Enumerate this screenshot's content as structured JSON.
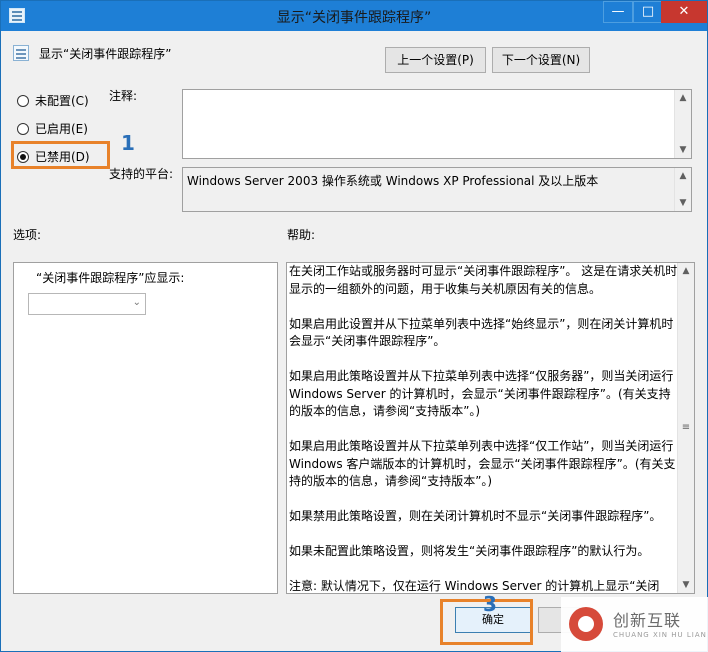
{
  "window": {
    "title": "显示“关闭事件跟踪程序”"
  },
  "titlebar_buttons": {
    "minimize": "—",
    "maximize": "□",
    "close": "✕"
  },
  "policy_name": "显示“关闭事件跟踪程序”",
  "nav": {
    "prev": "上一个设置(P)",
    "next": "下一个设置(N)"
  },
  "state_options": [
    {
      "label": "未配置(C)",
      "selected": false
    },
    {
      "label": "已启用(E)",
      "selected": false
    },
    {
      "label": "已禁用(D)",
      "selected": true
    }
  ],
  "annotations": {
    "marker1": "1",
    "marker3": "3",
    "highlight_color": "#e8822a",
    "marker_color": "#2a6fb8"
  },
  "comment": {
    "label": "注释:",
    "value": ""
  },
  "platform": {
    "label": "支持的平台:",
    "value": "Windows Server 2003 操作系统或 Windows XP Professional 及以上版本"
  },
  "sections": {
    "options": "选项:",
    "help": "帮助:"
  },
  "options_panel": {
    "label": "“关闭事件跟踪程序”应显示:",
    "dropdown_value": ""
  },
  "help_paragraphs": [
    "在关闭工作站或服务器时可显示“关闭事件跟踪程序”。 这是在请求关机时显示的一组额外的问题，用于收集与关机原因有关的信息。",
    "如果启用此设置并从下拉菜单列表中选择“始终显示”，则在闭关计算机时会显示“关闭事件跟踪程序”。",
    "如果启用此策略设置并从下拉菜单列表中选择“仅服务器”，则当关闭运行 Windows Server 的计算机时，会显示“关闭事件跟踪程序”。(有关支持的版本的信息，请参阅“支持版本”。)",
    "如果启用此策略设置并从下拉菜单列表中选择“仅工作站”，则当关闭运行 Windows 客户端版本的计算机时，会显示“关闭事件跟踪程序”。(有关支持的版本的信息，请参阅“支持版本”。)",
    "如果禁用此策略设置，则在关闭计算机时不显示“关闭事件跟踪程序”。",
    "如果未配置此策略设置，则将发生“关闭事件跟踪程序”的默认行为。",
    "注意: 默认情况下，仅在运行 Windows Server 的计算机上显示“关闭"
  ],
  "buttons": {
    "ok": "确定"
  },
  "watermark": {
    "main": "创新互联",
    "sub": "CHUANG XIN HU LIAN"
  },
  "colors": {
    "titlebar": "#1e7fd6",
    "close": "#c7372f",
    "accent": "#3c7fb1"
  }
}
